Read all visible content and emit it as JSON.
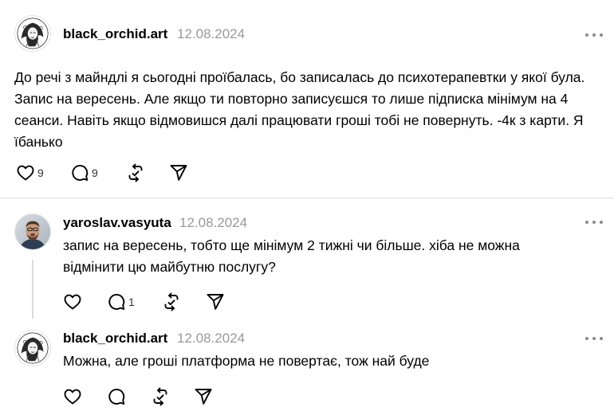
{
  "posts": [
    {
      "username": "black_orchid.art",
      "date": "12.08.2024",
      "text": "До речі з майндлі я сьогодні проїбалась, бо записалась до психотерапевтки у якої була. Запис на вересень. Але якщо ти повторно записуєшся то лише підписка мінімум на 4 сеанси. Навіть якщо відмовишся далі працювати гроші тобі не повернуть. -4к з карти. Я їбанько",
      "likes": "9",
      "replies": "9"
    },
    {
      "username": "yaroslav.vasyuta",
      "date": "12.08.2024",
      "text": "запис на вересень, тобто ще мінімум 2 тижні чи більше. хіба не можна відмінити цю майбутню послугу?",
      "likes": "",
      "replies": "1"
    },
    {
      "username": "black_orchid.art",
      "date": "12.08.2024",
      "text": "Можна, але гроші платформа не повертає, тож най буде",
      "likes": "",
      "replies": ""
    }
  ],
  "icons": {
    "like": "heart-icon",
    "reply": "comment-icon",
    "repost": "repost-icon",
    "share": "send-icon",
    "more": "more-dots-icon"
  },
  "colors": {
    "text": "#000000",
    "muted": "#999999",
    "divider": "#e0e0e0",
    "icon": "#000000"
  }
}
